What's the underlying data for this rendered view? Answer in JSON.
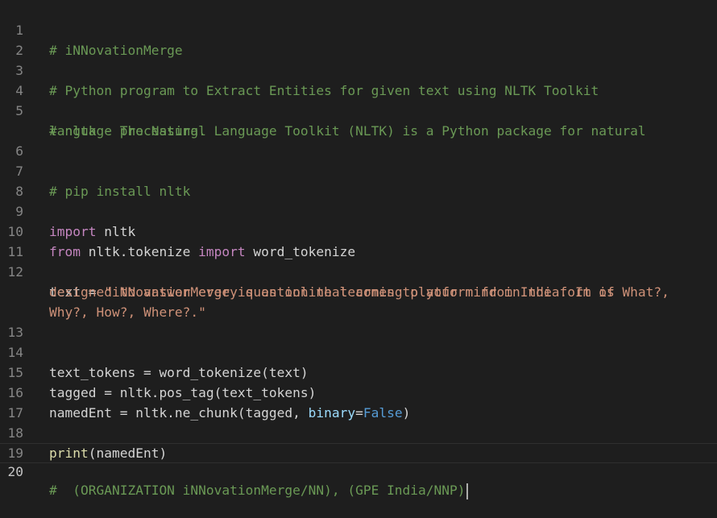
{
  "colors": {
    "background": "#1e1e1e",
    "line_number": "#858585",
    "comment": "#6a9955",
    "keyword": "#c586c0",
    "string": "#ce9178",
    "function": "#dcdcaa",
    "parameter": "#9cdcfe",
    "constant": "#569cd6",
    "text": "#d4d4d4"
  },
  "gutter": {
    "numbers": [
      "1",
      "2",
      "3",
      "4",
      "5",
      "6",
      "7",
      "8",
      "9",
      "10",
      "11",
      "12",
      "13",
      "14",
      "15",
      "16",
      "17",
      "18",
      "19",
      "20"
    ],
    "current_line": "20"
  },
  "code": {
    "l1": "# iNNovationMerge",
    "l3": "# Python program to Extract Entities for given text using NLTK Toolkit",
    "l5a": "# nltk - The Natural Language Toolkit (NLTK) is a Python package for natural",
    "l5b": "language processing.",
    "l7": "# pip install nltk",
    "l9_kw": "import",
    "l9_rest": " nltk",
    "l10_kw1": "from",
    "l10_mid": " nltk.tokenize ",
    "l10_kw2": "import",
    "l10_rest": " word_tokenize",
    "l12_pre": "text = ",
    "l12a": "\"iNNovationMerge is an online learning platform from India. It is",
    "l12b": "designed to answer every question that comes to your mind in the form of What?,",
    "l12c": "Why?, How?, Where?.\"",
    "l14": "text_tokens = word_tokenize(text)",
    "l15": "tagged = nltk.pos_tag(text_tokens)",
    "l16_pre": "namedEnt = nltk.ne_chunk(tagged, ",
    "l16_param": "binary",
    "l16_eq": "=",
    "l16_const": "False",
    "l16_close": ")",
    "l18_fn": "print",
    "l18_rest": "(namedEnt)",
    "l20": "#  (ORGANIZATION iNNovationMerge/NN), (GPE India/NNP)"
  }
}
